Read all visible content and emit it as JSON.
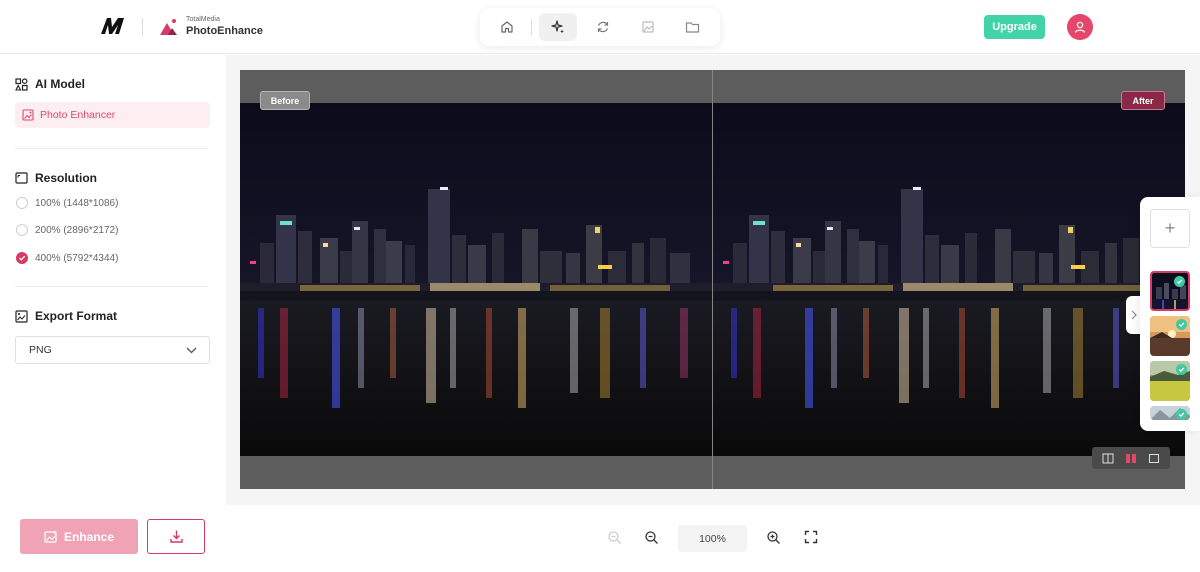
{
  "brand": {
    "small_text": "TotalMedia",
    "app_name": "PhotoEnhance"
  },
  "topnav": {
    "items": [
      {
        "icon": "home-icon",
        "active": false
      },
      {
        "icon": "sparkle-enhance-icon",
        "active": true
      },
      {
        "icon": "refresh-convert-icon",
        "active": false
      },
      {
        "icon": "image-crop-icon",
        "active": false
      },
      {
        "icon": "folder-icon",
        "active": false
      }
    ]
  },
  "header": {
    "upgrade_label": "Upgrade",
    "upgrade_color": "#43d3a9",
    "avatar_color": "#e5476a"
  },
  "sidebar": {
    "ai_model_title": "AI Model",
    "ai_model_value": "Photo Enhancer",
    "resolution_title": "Resolution",
    "resolutions": [
      {
        "label": "100% (1448*1086)",
        "checked": false
      },
      {
        "label": "200% (2896*2172)",
        "checked": false
      },
      {
        "label": "400% (5792*4344)",
        "checked": true
      }
    ],
    "export_title": "Export Format",
    "export_value": "PNG"
  },
  "viewer": {
    "before_label": "Before",
    "after_label": "After",
    "view_modes": [
      "split-view-icon",
      "side-by-side-icon",
      "single-view-icon"
    ],
    "active_view_mode": "side-by-side-icon"
  },
  "thumbnails": {
    "add_label": "+",
    "items": [
      {
        "name": "night-city-thumb",
        "done": true,
        "selected": true
      },
      {
        "name": "sunset-coast-thumb",
        "done": true,
        "selected": false
      },
      {
        "name": "green-field-thumb",
        "done": true,
        "selected": false
      },
      {
        "name": "mountain-thumb",
        "done": true,
        "selected": false
      }
    ]
  },
  "bottom": {
    "enhance_label": "Enhance",
    "zoom_value": "100%"
  },
  "colors": {
    "accent": "#d83a64",
    "accent_soft": "#f0a3b5",
    "success": "#43c9a0"
  }
}
